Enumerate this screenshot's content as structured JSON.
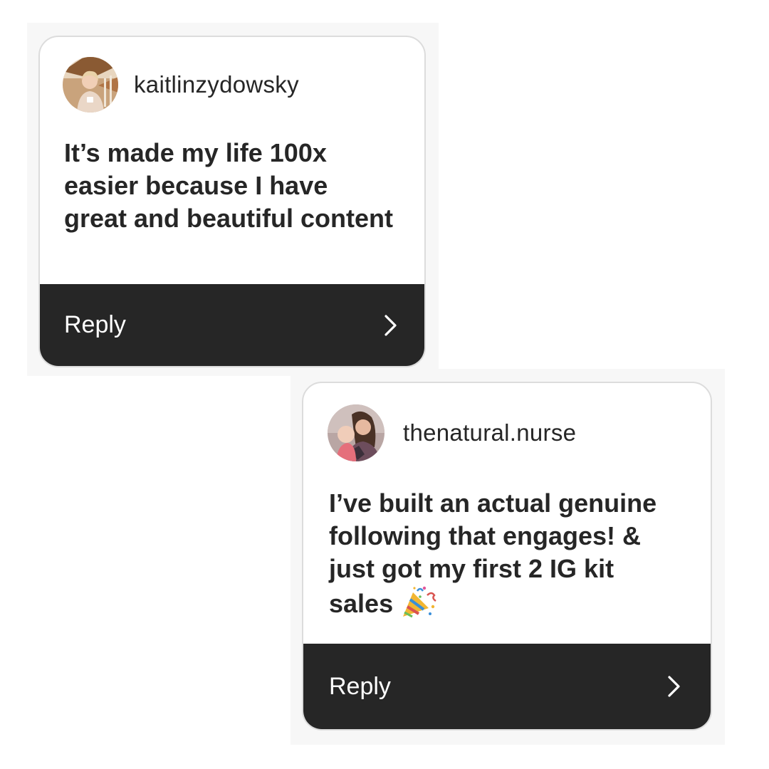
{
  "cards": [
    {
      "username": "kaitlinzydowsky",
      "message": "It’s made my life 100x easier because I have great and beautiful content",
      "reply_label": "Reply",
      "avatar_icon": "profile-photo",
      "chevron_icon": "chevron-right-icon"
    },
    {
      "username": "thenatural.nurse",
      "message": "I’ve built an actual genuine following that engages! & just got my first 2 IG kit sales",
      "message_emoji": "party-popper-icon",
      "reply_label": "Reply",
      "avatar_icon": "profile-photo",
      "chevron_icon": "chevron-right-icon"
    }
  ],
  "colors": {
    "text": "#262626",
    "reply_bar": "#262626",
    "card_border": "#dcdcdc",
    "backdrop": "#f7f7f7"
  }
}
